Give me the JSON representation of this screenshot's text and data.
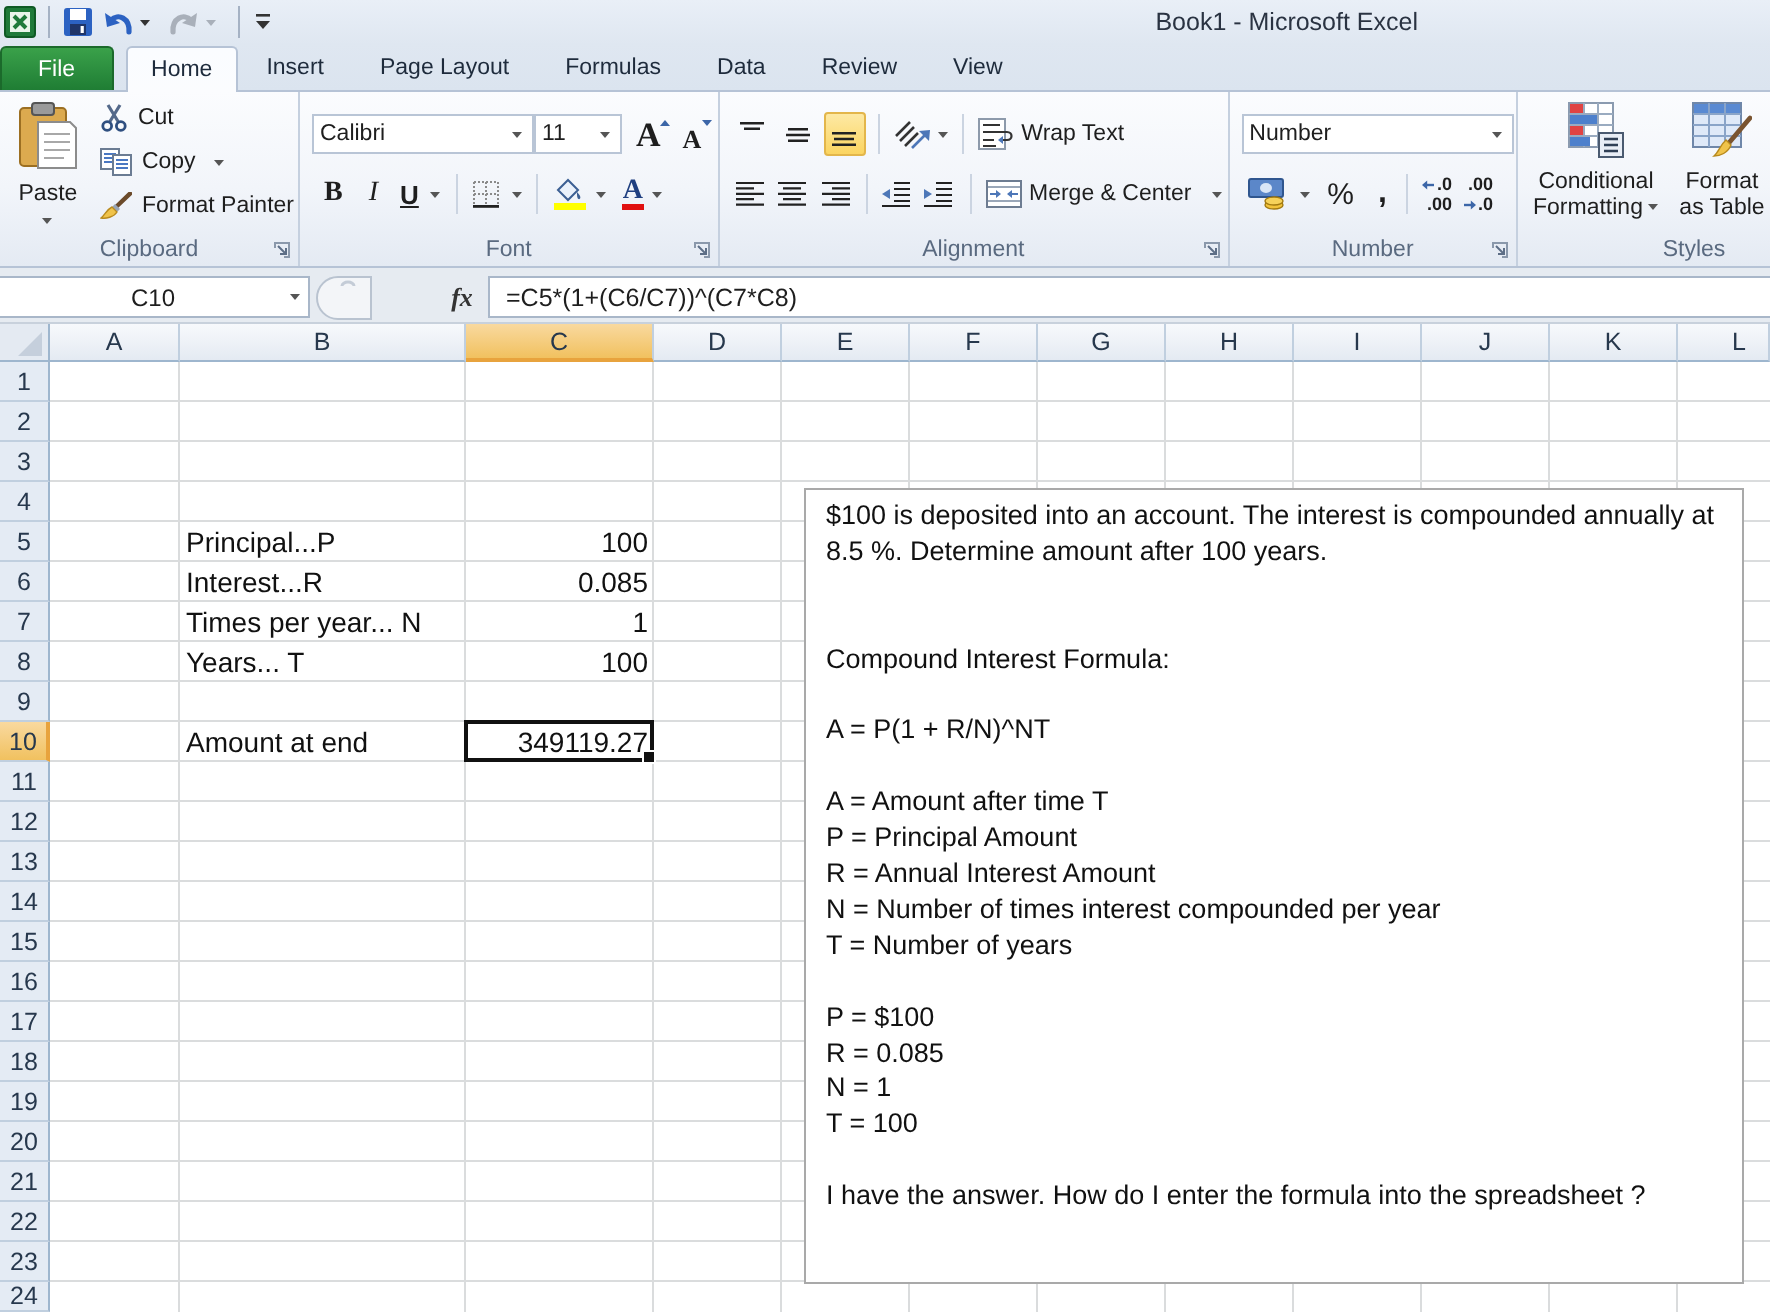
{
  "window": {
    "title": "Book1 - Microsoft Excel"
  },
  "quick_access": [
    {
      "kind": "save",
      "disabled": false
    },
    {
      "kind": "undo",
      "disabled": false
    },
    {
      "kind": "redo",
      "disabled": true
    }
  ],
  "tabs": [
    {
      "label": "File",
      "kind": "file",
      "selected": false
    },
    {
      "label": "Home",
      "kind": "tab",
      "selected": true
    },
    {
      "label": "Insert",
      "kind": "tab",
      "selected": false
    },
    {
      "label": "Page Layout",
      "kind": "tab",
      "selected": false
    },
    {
      "label": "Formulas",
      "kind": "tab",
      "selected": false
    },
    {
      "label": "Data",
      "kind": "tab",
      "selected": false
    },
    {
      "label": "Review",
      "kind": "tab",
      "selected": false
    },
    {
      "label": "View",
      "kind": "tab",
      "selected": false
    }
  ],
  "ribbon": {
    "clipboard": {
      "title": "Clipboard",
      "paste": "Paste",
      "cut": "Cut",
      "copy": "Copy",
      "format_painter": "Format Painter"
    },
    "font": {
      "title": "Font",
      "family": "Calibri",
      "size": "11",
      "grow": "A",
      "shrink": "A",
      "bold": "B",
      "italic": "I",
      "underline": "U",
      "font_color": "A"
    },
    "alignment": {
      "title": "Alignment",
      "vertical": [
        {
          "selected": false
        },
        {
          "selected": false
        },
        {
          "selected": true
        }
      ],
      "wrap_text": "Wrap Text",
      "merge_center": "Merge & Center"
    },
    "number": {
      "title": "Number",
      "format": "Number",
      "percent": "%",
      "comma": ",",
      "decimals": [
        {
          "top": ".0",
          "bottom": ".00"
        },
        {
          "top": ".00",
          "bottom": ".0"
        }
      ]
    },
    "styles": {
      "title": "Styles",
      "conditional_formatting": "Conditional Formatting",
      "format_table": "Format as Table"
    }
  },
  "formula_bar": {
    "name_box": "C10",
    "function_button": "fx",
    "formula": "=C5*(1+(C6/C7))^(C7*C8)"
  },
  "sheet": {
    "columns": [
      {
        "label": "A",
        "selected": false
      },
      {
        "label": "B",
        "selected": false
      },
      {
        "label": "C",
        "selected": true
      },
      {
        "label": "D",
        "selected": false
      },
      {
        "label": "E",
        "selected": false
      },
      {
        "label": "F",
        "selected": false
      },
      {
        "label": "G",
        "selected": false
      },
      {
        "label": "H",
        "selected": false
      },
      {
        "label": "I",
        "selected": false
      },
      {
        "label": "J",
        "selected": false
      },
      {
        "label": "K",
        "selected": false
      },
      {
        "label": "L",
        "selected": false
      }
    ],
    "rows": [
      {
        "label": "1",
        "selected": false
      },
      {
        "label": "2",
        "selected": false
      },
      {
        "label": "3",
        "selected": false
      },
      {
        "label": "4",
        "selected": false
      },
      {
        "label": "5",
        "selected": false,
        "column_b": "Principal...P",
        "column_c": "100"
      },
      {
        "label": "6",
        "selected": false,
        "column_b": "Interest...R",
        "column_c": "0.085"
      },
      {
        "label": "7",
        "selected": false,
        "column_b": "Times per year... N",
        "column_c": "1"
      },
      {
        "label": "8",
        "selected": false,
        "column_b": "Years... T",
        "column_c": "100"
      },
      {
        "label": "9",
        "selected": false
      },
      {
        "label": "10",
        "selected": true,
        "column_b": "Amount at end",
        "column_c": "349119.27"
      },
      {
        "label": "11",
        "selected": false
      },
      {
        "label": "12",
        "selected": false
      },
      {
        "label": "13",
        "selected": false
      },
      {
        "label": "14",
        "selected": false
      },
      {
        "label": "15",
        "selected": false
      },
      {
        "label": "16",
        "selected": false
      },
      {
        "label": "17",
        "selected": false
      },
      {
        "label": "18",
        "selected": false
      },
      {
        "label": "19",
        "selected": false
      },
      {
        "label": "20",
        "selected": false
      },
      {
        "label": "21",
        "selected": false
      },
      {
        "label": "22",
        "selected": false
      },
      {
        "label": "23",
        "selected": false
      },
      {
        "label": "24",
        "selected": false
      }
    ]
  },
  "text_box": {
    "blocks": [
      {
        "lines": [
          "$100 is deposited into an account. The interest is compounded annually at 8.5 %. Determine amount after 100 years."
        ]
      },
      {
        "lines": [
          "Compound Interest Formula:"
        ]
      },
      {
        "lines": [
          "A = P(1 + R/N)^NT"
        ]
      },
      {
        "lines": [
          "A = Amount after time T",
          "P = Principal Amount",
          "R = Annual Interest Amount",
          "N = Number of times interest compounded per year",
          "T = Number of years"
        ]
      },
      {
        "lines": [
          "P = $100",
          "R = 0.085",
          "N = 1",
          "T = 100"
        ]
      },
      {
        "lines": [
          "I have the answer. How do I enter the formula into the spreadsheet ?"
        ]
      }
    ]
  }
}
